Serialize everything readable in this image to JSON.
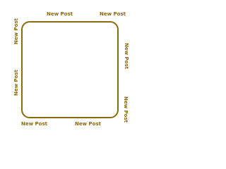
{
  "labels": {
    "top_left": "New Post",
    "top_right": "New Post",
    "left_top": "New Post",
    "left_bottom": "New Post",
    "right_top": "New Post",
    "right_bottom": "New Post",
    "bottom_left": "New Post",
    "bottom_right": "New Post"
  },
  "colors": {
    "frame": "#8a6a0c",
    "text": "#8a6a0c",
    "background": "#ffffff"
  }
}
